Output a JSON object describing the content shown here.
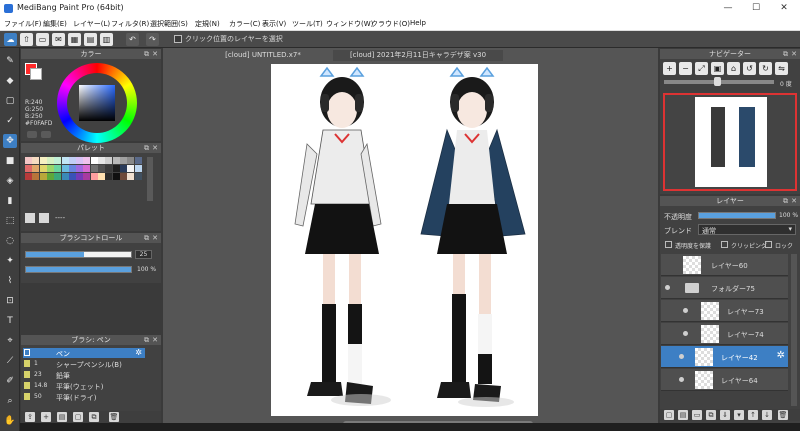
{
  "window": {
    "title": "MediBang Paint Pro (64bit)",
    "minimize": "—",
    "maximize": "☐",
    "close": "✕"
  },
  "menu": [
    "ファイル(F)",
    "編集(E)",
    "レイヤー(L)",
    "フィルタ(R)",
    "選択範囲(S)",
    "定規(N)",
    "カラー(C)",
    "表示(V)",
    "ツール(T)",
    "ウィンドウ(W)",
    "クラウド(O)",
    "Help"
  ],
  "toolbar": {
    "checkbox_label": "クリック位置のレイヤーを選択",
    "checkbox_checked": false
  },
  "color_panel": {
    "title": "カラー",
    "r_label": "R:240",
    "g_label": "G:250",
    "b_label": "B:250",
    "hex_label": "#F0FAFD",
    "primary_color": "#ff2a2a",
    "secondary_color": "#ffffff"
  },
  "palette_panel": {
    "title": "パレット",
    "footer": "----"
  },
  "brush_control": {
    "title": "ブラシコントロール",
    "size_value": "25",
    "opacity_value": "100 %",
    "size_fraction": 0.55,
    "opacity_fraction": 1.0
  },
  "brush_panel": {
    "title": "ブラシ: ペン",
    "items": [
      {
        "size": "",
        "name": "ペン",
        "selected": true
      },
      {
        "size": "1",
        "name": "シャープペンシル(B)",
        "selected": false
      },
      {
        "size": "23",
        "name": "鉛筆",
        "selected": false
      },
      {
        "size": "14.8",
        "name": "平筆(ウェット)",
        "selected": false
      },
      {
        "size": "50",
        "name": "平筆(ドライ)",
        "selected": false
      }
    ]
  },
  "canvas": {
    "tabs": [
      "[cloud] UNTITLED.x7*",
      "[cloud] 2021年2月11日キャラデザ案 v30"
    ]
  },
  "navigator": {
    "title": "ナビゲーター",
    "zoom_fraction": 0.48,
    "rotation_label": "0 度"
  },
  "layer_panel": {
    "title": "レイヤー",
    "opacity_label": "不透明度",
    "opacity_value": "100 %",
    "blend_label": "ブレンド",
    "blend_value": "通常",
    "protect_alpha": "透明度を保護",
    "clipping": "クリッピング",
    "lock": "ロック",
    "layers": [
      {
        "name": "レイヤー60",
        "type": "layer",
        "indent": 0,
        "selected": false
      },
      {
        "name": "フォルダー75",
        "type": "folder",
        "indent": 0,
        "selected": false
      },
      {
        "name": "レイヤー73",
        "type": "layer",
        "indent": 1,
        "selected": false
      },
      {
        "name": "レイヤー74",
        "type": "layer",
        "indent": 1,
        "selected": false
      },
      {
        "name": "レイヤー42",
        "type": "layer",
        "indent": 1,
        "selected": true
      },
      {
        "name": "レイヤー64",
        "type": "layer",
        "indent": 1,
        "selected": false
      }
    ]
  },
  "colors": {
    "accent": "#3d7fc4",
    "panel": "#414141",
    "canvas_bg": "#555555"
  }
}
